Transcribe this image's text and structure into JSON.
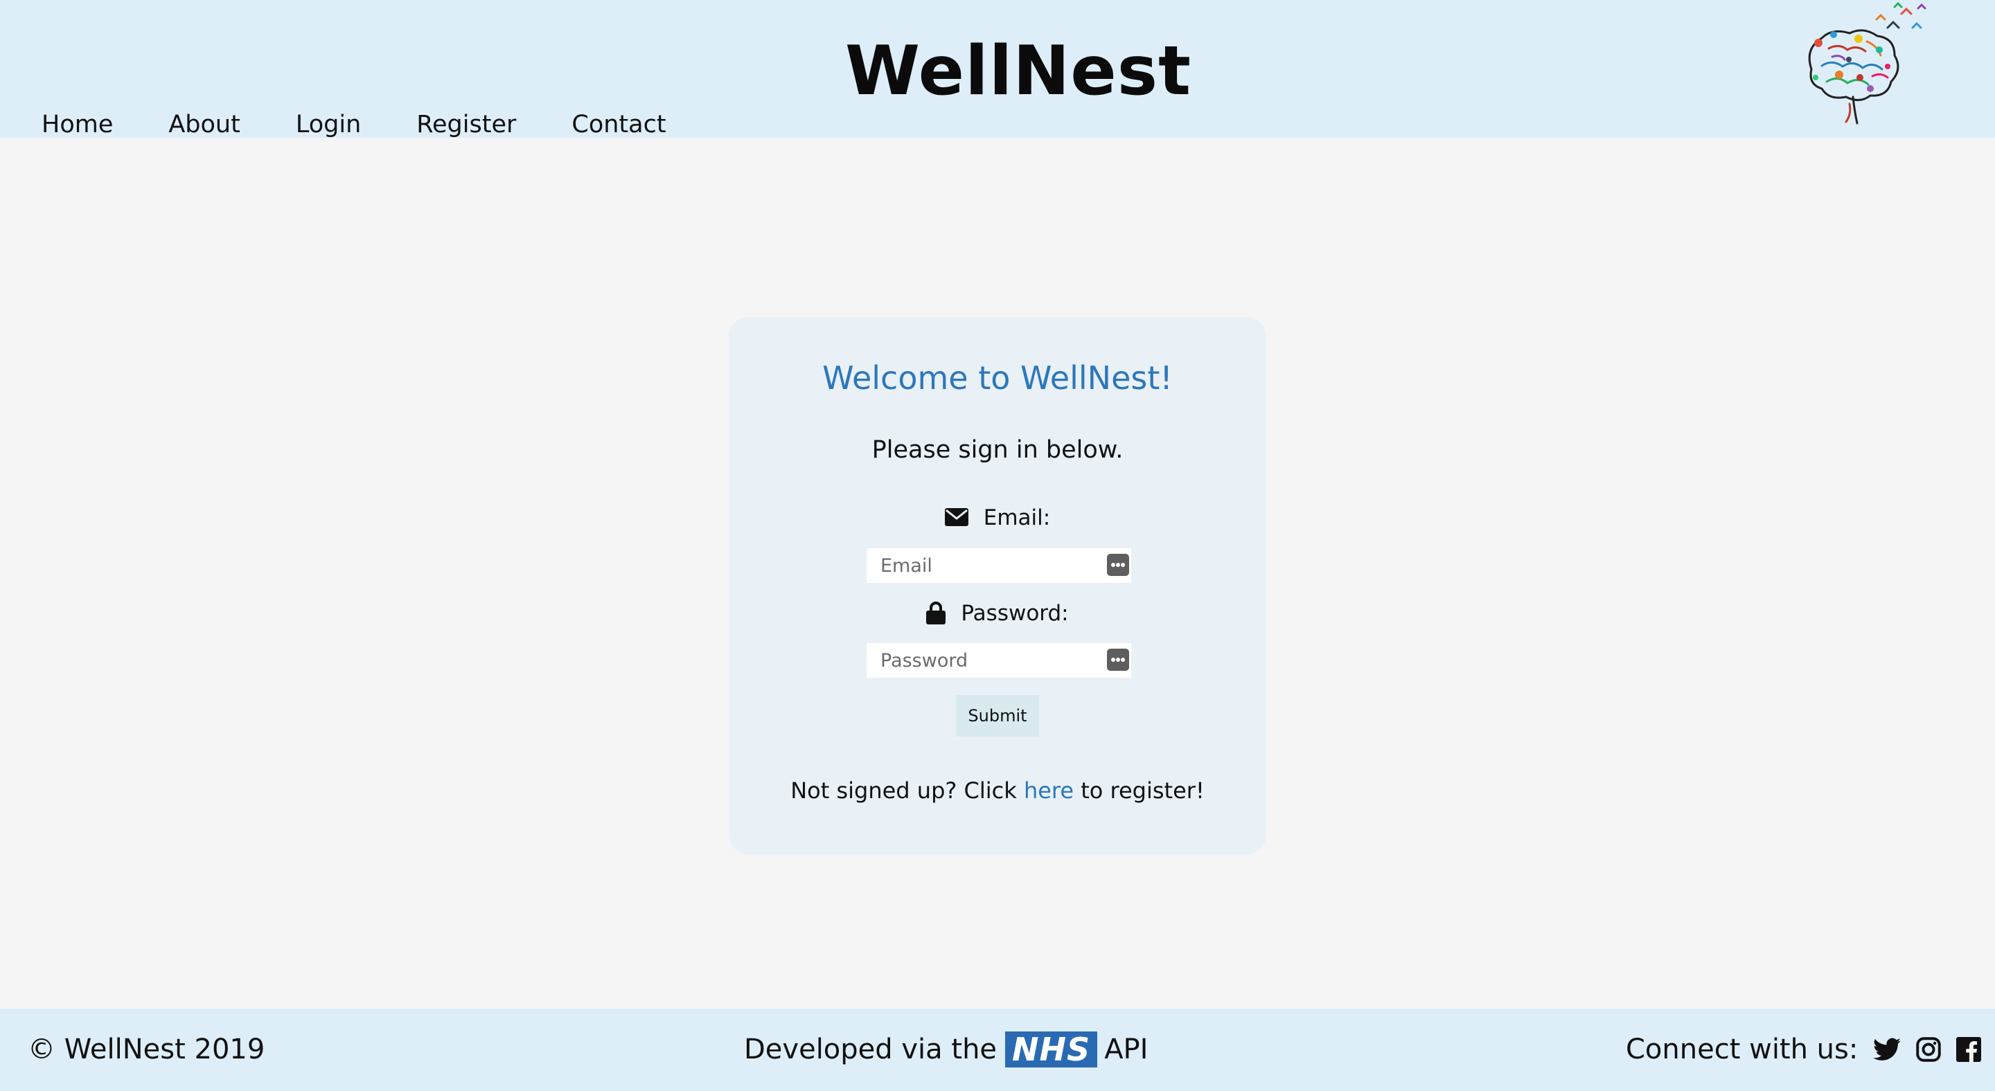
{
  "header": {
    "site_title": "WellNest",
    "nav": [
      {
        "label": "Home"
      },
      {
        "label": "About"
      },
      {
        "label": "Login"
      },
      {
        "label": "Register"
      },
      {
        "label": "Contact"
      }
    ],
    "logo_icon": "colorful-brain-logo"
  },
  "login_card": {
    "heading": "Welcome to WellNest!",
    "prompt": "Please sign in below.",
    "email": {
      "label": "Email:",
      "icon": "envelope-icon",
      "placeholder": "Email",
      "value": ""
    },
    "password": {
      "label": "Password:",
      "icon": "lock-icon",
      "placeholder": "Password",
      "value": ""
    },
    "submit_label": "Submit",
    "register_prefix": "Not signed up? Click ",
    "register_link": "here",
    "register_suffix": " to register!"
  },
  "footer": {
    "copyright": "© WellNest 2019",
    "developed_prefix": "Developed via the",
    "nhs_logo_text": "NHS",
    "developed_suffix": "API",
    "connect_label": "Connect with us:",
    "social_icons": [
      "twitter-icon",
      "instagram-icon",
      "facebook-icon"
    ]
  },
  "colors": {
    "header_bg": "#deeef8",
    "page_bg": "#f5f5f5",
    "card_bg": "#e9f1f7",
    "accent_blue": "#2c77bb",
    "nhs_blue": "#2a6ab3",
    "submit_bg": "#d9eaee"
  }
}
